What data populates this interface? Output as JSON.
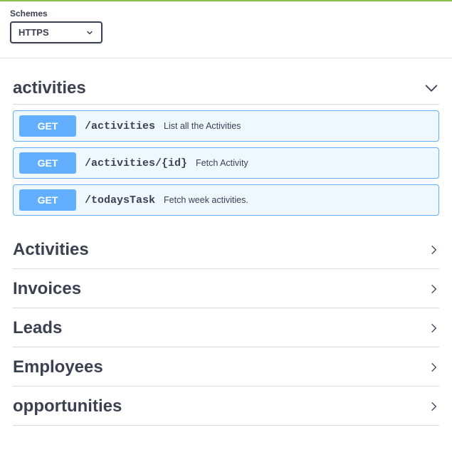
{
  "schemes": {
    "label": "Schemes",
    "selected": "HTTPS"
  },
  "expandedTag": {
    "name": "activities",
    "endpoints": [
      {
        "method": "GET",
        "path": "/activities",
        "description": "List all the Activities"
      },
      {
        "method": "GET",
        "path": "/activities/{id}",
        "description": "Fetch Activity"
      },
      {
        "method": "GET",
        "path": "/todaysTask",
        "description": "Fetch week activities."
      }
    ]
  },
  "collapsedTags": [
    {
      "name": "Activities"
    },
    {
      "name": "Invoices"
    },
    {
      "name": "Leads"
    },
    {
      "name": "Employees"
    },
    {
      "name": "opportunities"
    }
  ]
}
